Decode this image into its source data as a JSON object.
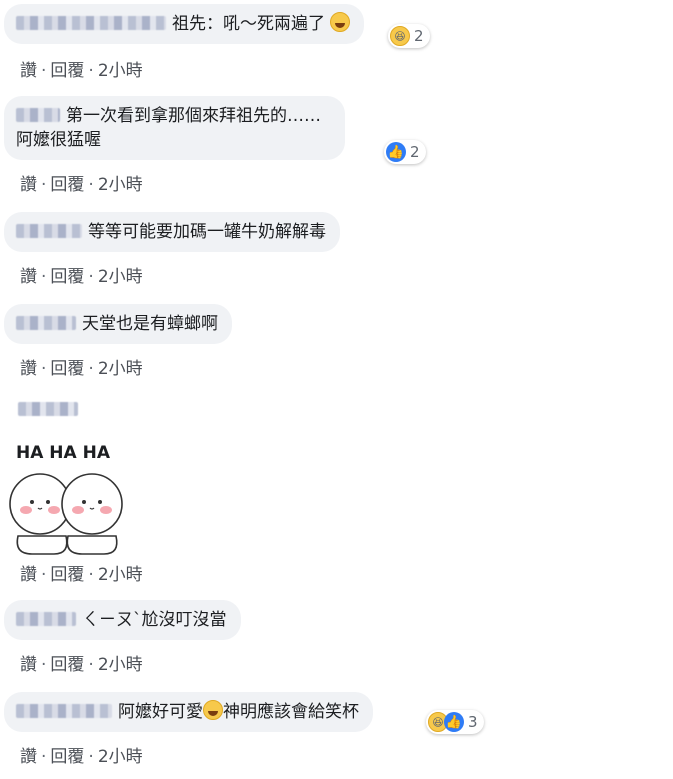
{
  "actions": {
    "like": "讚",
    "sep": "·",
    "reply": "回覆",
    "time": "2小時"
  },
  "comments": [
    {
      "text": "祖先：吼～死兩遍了",
      "reaction_count": "2"
    },
    {
      "line1": "第一次看到拿那個來拜祖先的……",
      "line2": "阿嬤很猛喔",
      "reaction_count": "2"
    },
    {
      "text": "等等可能要加碼一罐牛奶解解毒"
    },
    {
      "text": "天堂也是有蟑螂啊"
    },
    {
      "sticker_text": "HA HA HA"
    },
    {
      "text": "ㄑㄧㄡˋ尬沒叮沒當"
    },
    {
      "text1": "阿嬤好可愛",
      "text2": "神明應該會給笑杯",
      "reaction_count": "3"
    }
  ],
  "icons": {
    "haha": "haha-reaction-icon",
    "like": "like-reaction-icon"
  },
  "colors": {
    "bubble": "#f0f2f5",
    "like_blue": "#2f7cf6",
    "haha_yellow": "#f7c94b",
    "action_text": "#4b4f56"
  }
}
